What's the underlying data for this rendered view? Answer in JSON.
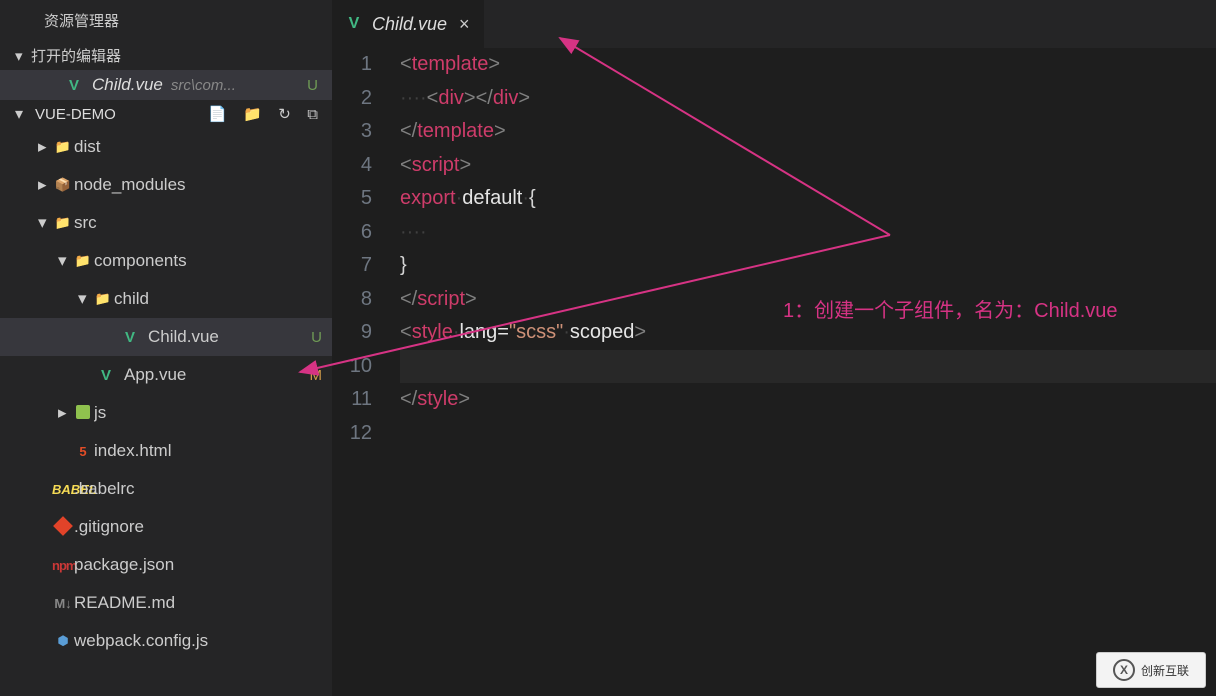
{
  "sidebar": {
    "title": "资源管理器",
    "openEditors": {
      "header": "打开的编辑器",
      "item": {
        "name": "Child.vue",
        "path": "src\\com...",
        "status": "U"
      }
    },
    "project": {
      "name": "VUE-DEMO",
      "actions": {
        "newFile": "new-file",
        "newFolder": "new-folder",
        "refresh": "refresh",
        "collapse": "collapse"
      }
    },
    "tree": {
      "dist": "dist",
      "node_modules": "node_modules",
      "src": "src",
      "components": "components",
      "child": "child",
      "childVue": "Child.vue",
      "childVueStatus": "U",
      "appVue": "App.vue",
      "appVueStatus": "M",
      "js": "js",
      "indexHtml": "index.html",
      "babelrc": ".babelrc",
      "gitignore": ".gitignore",
      "packageJson": "package.json",
      "readme": "README.md",
      "webpack": "webpack.config.js"
    }
  },
  "tab": {
    "name": "Child.vue"
  },
  "gutter": [
    "1",
    "2",
    "3",
    "4",
    "5",
    "6",
    "7",
    "8",
    "9",
    "10",
    "11",
    "12"
  ],
  "code": {
    "line2_ws": "····",
    "line6_ws": "····",
    "tags": {
      "template": "template",
      "div": "div",
      "script": "script",
      "style": "style"
    },
    "kw": {
      "export": "export",
      "default": "default"
    },
    "attrs": {
      "lang": "lang",
      "scoped": "scoped"
    },
    "vals": {
      "scss": "\"scss\""
    },
    "br": {
      "lt": "<",
      "gt": ">",
      "lts": "</",
      "lbr": "{",
      "rbr": "}"
    },
    "dot": "·",
    "sp": " "
  },
  "annotation": "1：创建一个子组件，名为：Child.vue",
  "logo": "创新互联"
}
